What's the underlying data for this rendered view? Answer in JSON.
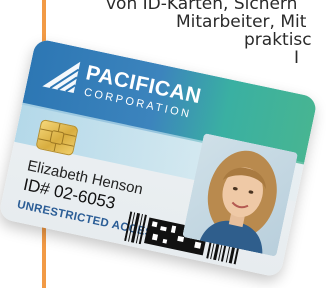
{
  "background_text": [
    "von ID-Karten, Sicherh",
    "Mitarbeiter, Mit",
    "praktisc",
    "I"
  ],
  "card": {
    "company_name": "PACIFICAN",
    "company_sub": "CORPORATION",
    "holder_name": "Elizabeth Henson",
    "holder_id": "ID# 02-6053",
    "access_label": "UNRESTRICTED ACCESS"
  },
  "colors": {
    "accent_bar": "#f29a45",
    "card_header_blue": "#2d77b4",
    "card_header_green": "#47b592",
    "access_text": "#2b5d96"
  },
  "icons": {
    "logo": "pacifican-logo-icon",
    "chip": "smart-chip-icon",
    "barcode": "barcode-icon"
  }
}
